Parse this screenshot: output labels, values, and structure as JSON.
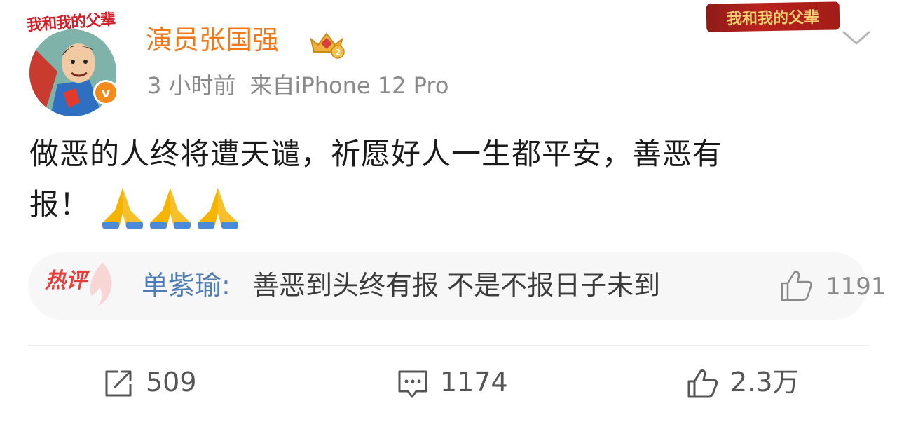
{
  "avatar": {
    "pendant_text": "我和我的父辈"
  },
  "user": {
    "name": "演员张国强",
    "verified_mark": "v"
  },
  "post": {
    "time": "3 小时前",
    "source": "来自iPhone 12 Pro",
    "text_line1": "做恶的人终将遭天谴，祈愿好人一生都平安，善恶有",
    "text_line2": "报！"
  },
  "card_pendant": {
    "text": "我和我的父辈"
  },
  "hot_comment": {
    "tag": "热评",
    "user": "单紫瑜:",
    "text": "善恶到头终有报 不是不报日子未到",
    "likes": "1191"
  },
  "actions": {
    "reposts": "509",
    "comments": "1174",
    "likes": "2.3万"
  },
  "colors": {
    "username": "#f07a1a",
    "commenter": "#4f7db3",
    "hot_tag": "#e43d3d",
    "verified": "#f28b1c"
  },
  "icons": [
    "crown-badge-icon",
    "more-chevron-icon",
    "pray-emoji-icon",
    "flame-icon",
    "thumbs-up-icon",
    "repost-icon",
    "comment-icon"
  ]
}
